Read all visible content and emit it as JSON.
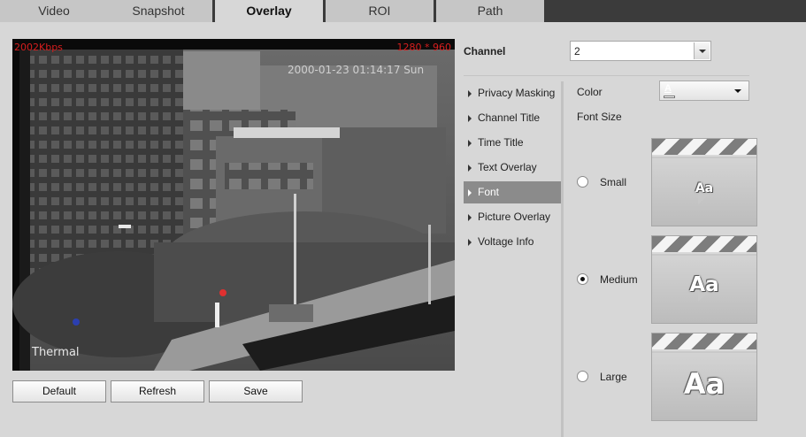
{
  "tabs": [
    {
      "label": "Video",
      "active": false
    },
    {
      "label": "Snapshot",
      "active": false
    },
    {
      "label": "Overlay",
      "active": true
    },
    {
      "label": "ROI",
      "active": false
    },
    {
      "label": "Path",
      "active": false
    }
  ],
  "video": {
    "bitrate": "2002Kbps",
    "resolution": "1280 * 960",
    "timestamp": "2000-01-23 01:14:17 Sun",
    "channel_label": "Thermal"
  },
  "buttons": {
    "default": "Default",
    "refresh": "Refresh",
    "save": "Save"
  },
  "channel": {
    "label": "Channel",
    "value": "2"
  },
  "menu": [
    {
      "label": "Privacy Masking",
      "active": false
    },
    {
      "label": "Channel Title",
      "active": false
    },
    {
      "label": "Time Title",
      "active": false
    },
    {
      "label": "Text Overlay",
      "active": false
    },
    {
      "label": "Font",
      "active": true
    },
    {
      "label": "Picture Overlay",
      "active": false
    },
    {
      "label": "Voltage Info",
      "active": false
    }
  ],
  "font": {
    "color_label": "Color",
    "color_value_icon": "font-color-A-icon",
    "color_value": "#ffffff",
    "size_label": "Font Size",
    "sizes": [
      {
        "label": "Small",
        "checked": false,
        "sample": "Aa"
      },
      {
        "label": "Medium",
        "checked": true,
        "sample": "Aa"
      },
      {
        "label": "Large",
        "checked": false,
        "sample": "Aa"
      }
    ]
  },
  "colors": {
    "tabbar_bg": "#3b3b3b",
    "osd_red": "#d81e1e",
    "menu_active_bg": "#8b8b8b"
  }
}
